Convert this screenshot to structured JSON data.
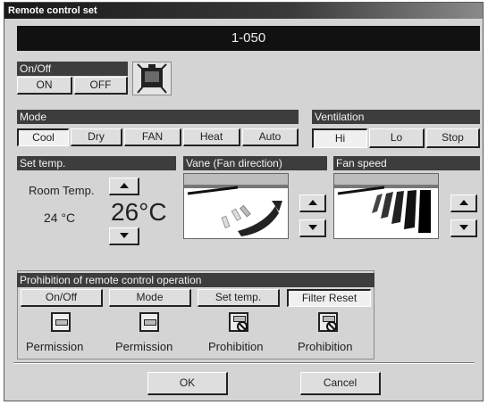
{
  "window": {
    "title": "Remote control set"
  },
  "unit_id": "1-050",
  "onoff": {
    "header": "On/Off",
    "on_label": "ON",
    "off_label": "OFF",
    "icon": "indoor-unit-icon"
  },
  "mode": {
    "header": "Mode",
    "options": [
      "Cool",
      "Dry",
      "FAN",
      "Heat",
      "Auto"
    ],
    "selected": "Cool"
  },
  "ventilation": {
    "header": "Ventilation",
    "options": [
      "Hi",
      "Lo",
      "Stop"
    ],
    "selected": "Hi"
  },
  "set_temp": {
    "header": "Set temp.",
    "room_label": "Room Temp.",
    "room_value": "24 °C",
    "set_value": "26°C"
  },
  "vane": {
    "header": "Vane (Fan direction)"
  },
  "fan_speed": {
    "header": "Fan speed"
  },
  "prohibition": {
    "header": "Prohibition of remote control operation",
    "items": [
      {
        "label": "On/Off",
        "status": "Permission"
      },
      {
        "label": "Mode",
        "status": "Permission"
      },
      {
        "label": "Set temp.",
        "status": "Prohibition"
      },
      {
        "label": "Filter Reset",
        "status": "Prohibition"
      }
    ]
  },
  "footer": {
    "ok_label": "OK",
    "cancel_label": "Cancel"
  }
}
